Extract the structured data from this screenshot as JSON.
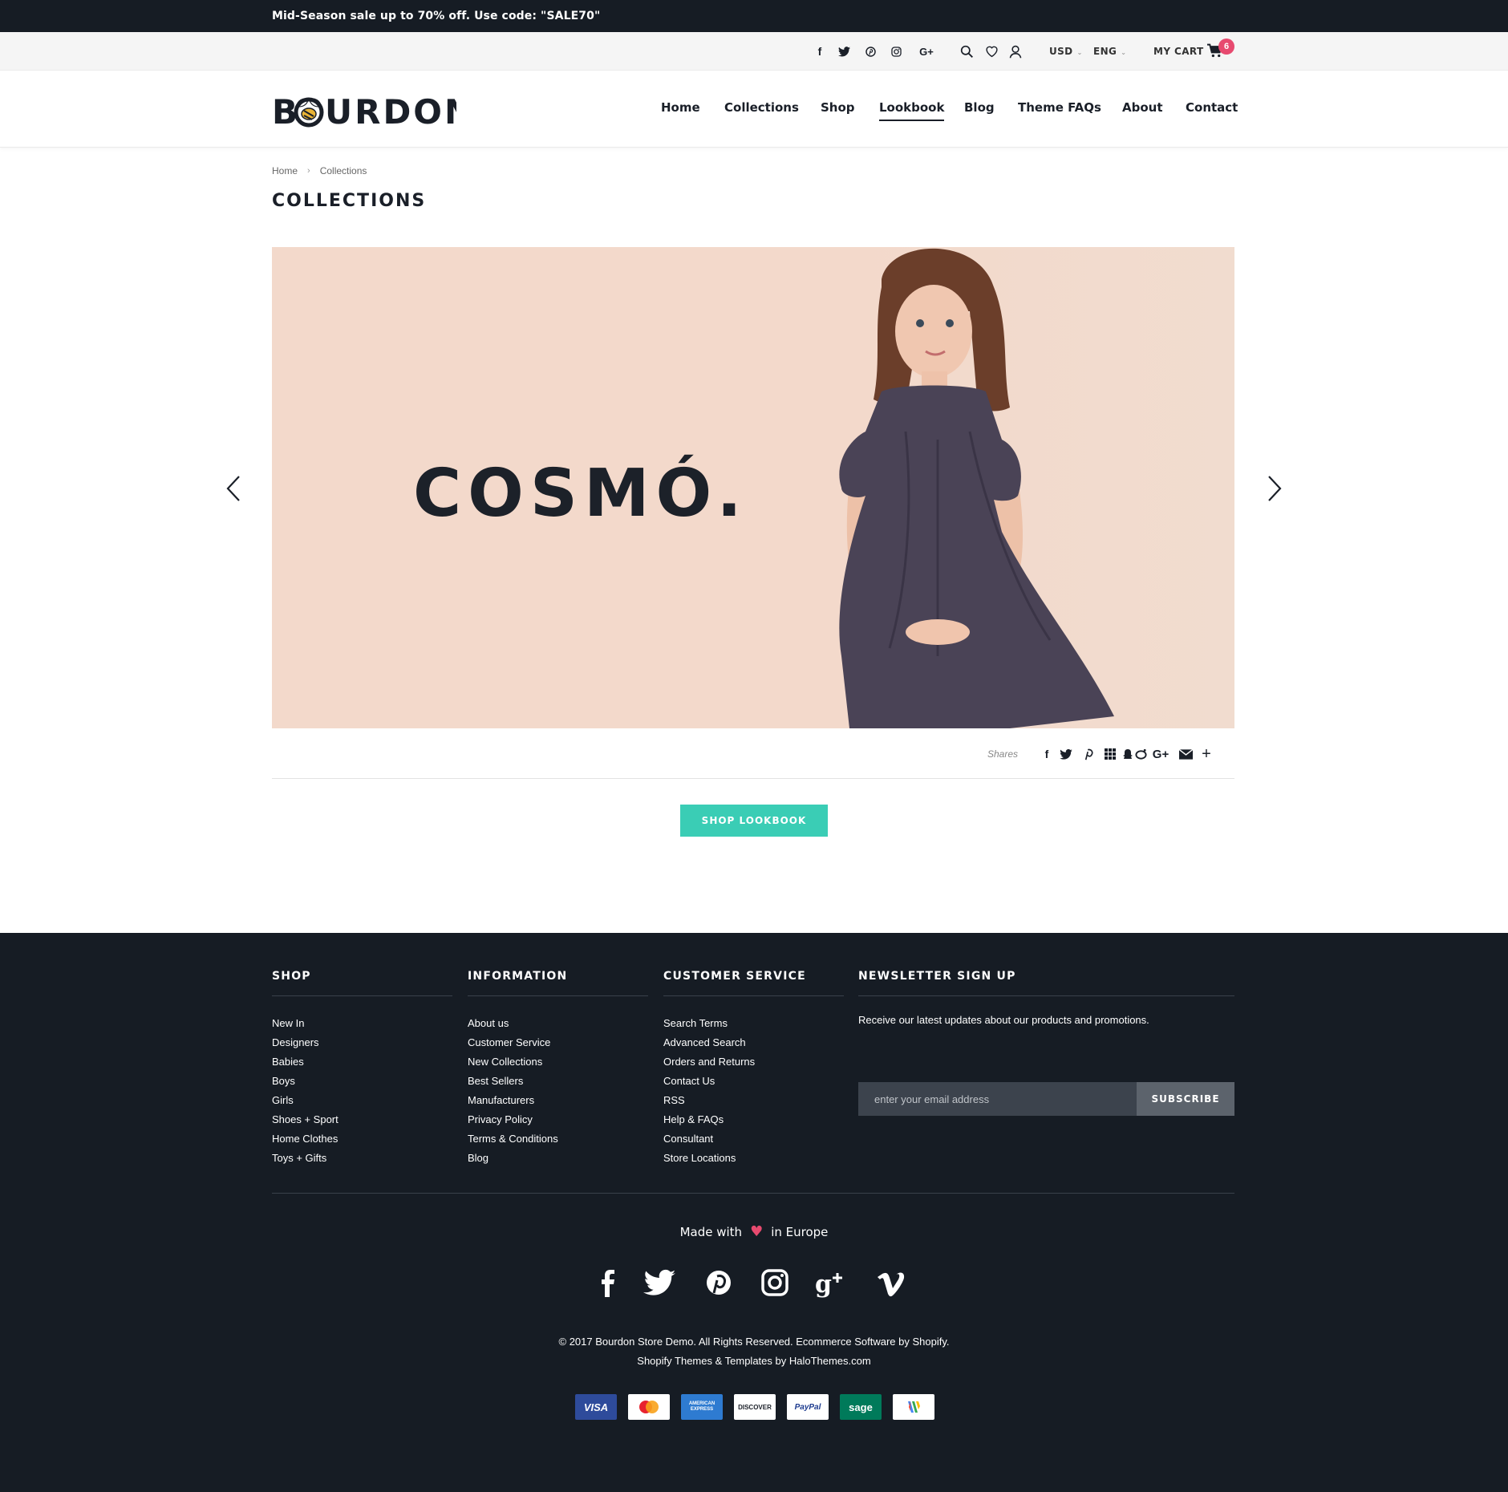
{
  "announcement": "Mid-Season sale up to 70% off. Use code: \"SALE70\"",
  "utility": {
    "currency": "USD",
    "language": "ENG",
    "cart_label": "MY CART",
    "cart_count": "6"
  },
  "logo_text": "BOURDON",
  "nav": [
    "Home",
    "Collections",
    "Shop",
    "Lookbook",
    "Blog",
    "Theme FAQs",
    "About",
    "Contact"
  ],
  "nav_active": "Lookbook",
  "breadcrumb": {
    "home": "Home",
    "current": "Collections"
  },
  "page_title": "COLLECTIONS",
  "hero": {
    "brand": "COSMÓ.",
    "bg_color": "#f3d9cb"
  },
  "shares_label": "Shares",
  "shop_button": "SHOP LOOKBOOK",
  "footer": {
    "shop": {
      "title": "SHOP",
      "items": [
        "New In",
        "Designers",
        "Babies",
        "Boys",
        "Girls",
        "Shoes + Sport",
        "Home Clothes",
        "Toys + Gifts"
      ]
    },
    "information": {
      "title": "INFORMATION",
      "items": [
        "About us",
        "Customer Service",
        "New Collections",
        "Best Sellers",
        "Manufacturers",
        "Privacy Policy",
        "Terms & Conditions",
        "Blog"
      ]
    },
    "customer_service": {
      "title": "CUSTOMER SERVICE",
      "items": [
        "Search Terms",
        "Advanced Search",
        "Orders and Returns",
        "Contact Us",
        "RSS",
        "Help & FAQs",
        "Consultant",
        "Store Locations"
      ]
    },
    "newsletter": {
      "title": "NEWSLETTER SIGN UP",
      "text": "Receive our latest updates about our products and promotions.",
      "placeholder": "enter your email address",
      "button": "SUBSCRIBE"
    },
    "made_with_before": "Made with",
    "made_with_after": "in Europe",
    "copyright_line1": "© 2017 Bourdon Store Demo. All Rights Reserved. Ecommerce Software by Shopify.",
    "copyright_line2": "Shopify Themes & Templates by HaloThemes.com",
    "payments": [
      "VISA",
      "MasterCard",
      "AMERICAN EXPRESS",
      "DISCOVER",
      "PayPal",
      "sage",
      "Google Wallet"
    ]
  },
  "colors": {
    "dark": "#161c24",
    "accent": "#3acdb5",
    "badge": "#e74a6f"
  }
}
